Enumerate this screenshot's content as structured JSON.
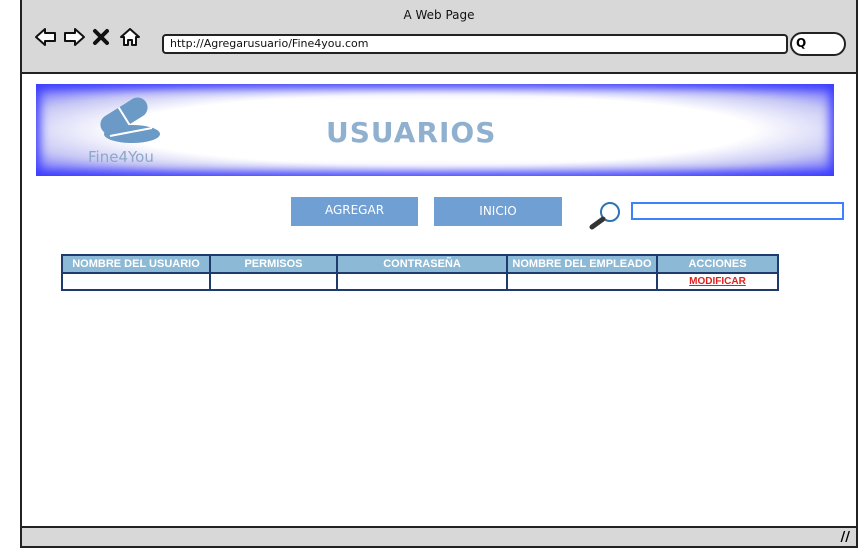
{
  "window": {
    "title": "A Web Page"
  },
  "address_bar": {
    "url": "http://Agregarusuario/Fine4you.com"
  },
  "banner": {
    "logo_text": "Fine4You",
    "title": "USUARIOS"
  },
  "toolbar": {
    "add_label": "AGREGAR",
    "home_label": "INICIO",
    "search_value": ""
  },
  "table": {
    "headers": [
      "NOMBRE DEL USUARIO",
      "PERMISOS",
      "CONTRASEÑA",
      "NOMBRE DEL EMPLEADO",
      "ACCIONES"
    ],
    "rows": [
      {
        "usuario": "",
        "permisos": "",
        "contrasena": "",
        "empleado": "",
        "accion": "MODIFICAR"
      }
    ]
  },
  "colors": {
    "button": "#6f9fd3",
    "header": "#8cb9d6",
    "border": "#1f3b6d",
    "link": "#e0201d"
  }
}
